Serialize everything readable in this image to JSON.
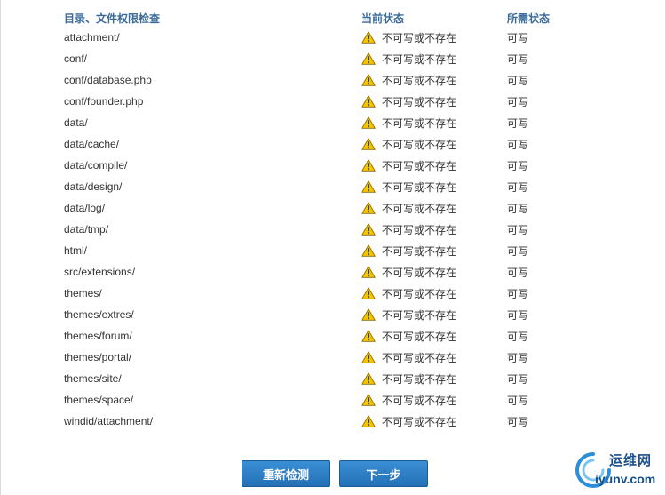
{
  "table": {
    "headers": {
      "path": "目录、文件权限检查",
      "current": "当前状态",
      "required": "所需状态"
    },
    "rows": [
      {
        "path": "attachment/",
        "current": "不可写或不存在",
        "required": "可写"
      },
      {
        "path": "conf/",
        "current": "不可写或不存在",
        "required": "可写"
      },
      {
        "path": "conf/database.php",
        "current": "不可写或不存在",
        "required": "可写"
      },
      {
        "path": "conf/founder.php",
        "current": "不可写或不存在",
        "required": "可写"
      },
      {
        "path": "data/",
        "current": "不可写或不存在",
        "required": "可写"
      },
      {
        "path": "data/cache/",
        "current": "不可写或不存在",
        "required": "可写"
      },
      {
        "path": "data/compile/",
        "current": "不可写或不存在",
        "required": "可写"
      },
      {
        "path": "data/design/",
        "current": "不可写或不存在",
        "required": "可写"
      },
      {
        "path": "data/log/",
        "current": "不可写或不存在",
        "required": "可写"
      },
      {
        "path": "data/tmp/",
        "current": "不可写或不存在",
        "required": "可写"
      },
      {
        "path": "html/",
        "current": "不可写或不存在",
        "required": "可写"
      },
      {
        "path": "src/extensions/",
        "current": "不可写或不存在",
        "required": "可写"
      },
      {
        "path": "themes/",
        "current": "不可写或不存在",
        "required": "可写"
      },
      {
        "path": "themes/extres/",
        "current": "不可写或不存在",
        "required": "可写"
      },
      {
        "path": "themes/forum/",
        "current": "不可写或不存在",
        "required": "可写"
      },
      {
        "path": "themes/portal/",
        "current": "不可写或不存在",
        "required": "可写"
      },
      {
        "path": "themes/site/",
        "current": "不可写或不存在",
        "required": "可写"
      },
      {
        "path": "themes/space/",
        "current": "不可写或不存在",
        "required": "可写"
      },
      {
        "path": "windid/attachment/",
        "current": "不可写或不存在",
        "required": "可写"
      }
    ]
  },
  "buttons": {
    "recheck": "重新检测",
    "next": "下一步"
  },
  "watermark": {
    "name": "运维网",
    "domain": "iyunv.com"
  },
  "icons": {
    "status": "warning-icon"
  },
  "colors": {
    "header_text": "#3a6a9a",
    "button_bg": "#2a7bc0",
    "warning_fill": "#f5c400"
  }
}
